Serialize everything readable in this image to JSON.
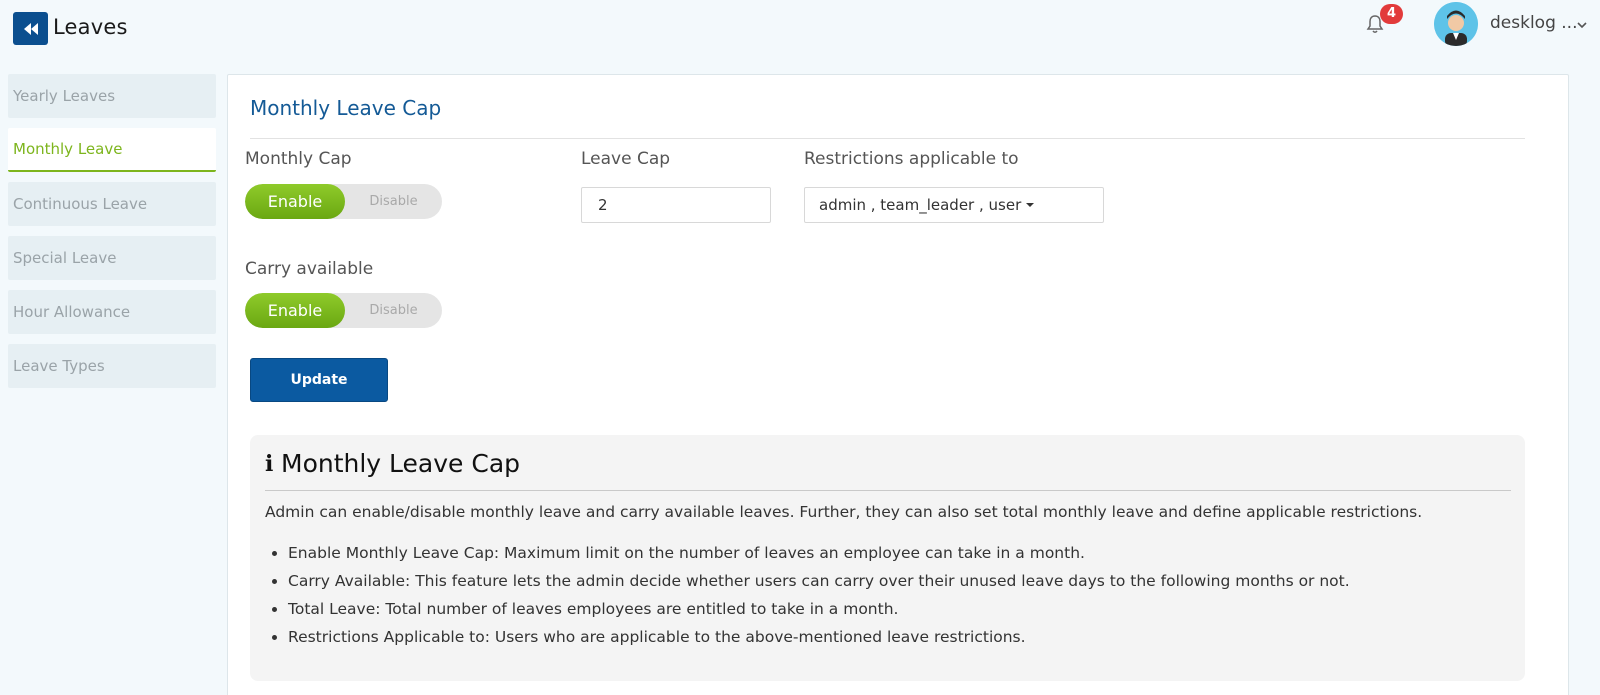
{
  "header": {
    "title": "Leaves",
    "notification_count": "4",
    "user_name": "desklog ..."
  },
  "sidebar": {
    "items": [
      {
        "label": "Yearly Leaves"
      },
      {
        "label": "Monthly Leave"
      },
      {
        "label": "Continuous Leave"
      },
      {
        "label": "Special Leave"
      },
      {
        "label": "Hour Allowance"
      },
      {
        "label": "Leave Types"
      }
    ],
    "active_index": 1
  },
  "main": {
    "title": "Monthly Leave Cap",
    "monthly_cap": {
      "label": "Monthly Cap",
      "on_label": "Enable",
      "off_label": "Disable"
    },
    "leave_cap": {
      "label": "Leave Cap",
      "value": "2"
    },
    "restrictions": {
      "label": "Restrictions applicable to",
      "value": "admin , team_leader , user"
    },
    "carry_available": {
      "label": "Carry available",
      "on_label": "Enable",
      "off_label": "Disable"
    },
    "update_label": "Update"
  },
  "info": {
    "heading": "Monthly Leave Cap",
    "description": "Admin can enable/disable monthly leave and carry available leaves. Further, they can also set total monthly leave and define applicable restrictions.",
    "bullets": [
      "Enable Monthly Leave Cap: Maximum limit on the number of leaves an employee can take in a month.",
      "Carry Available: This feature lets the admin decide whether users can carry over their unused leave days to the following months or not.",
      "Total Leave: Total number of leaves employees are entitled to take in a month.",
      "Restrictions Applicable to: Users who are applicable to the above-mentioned leave restrictions."
    ]
  },
  "colors": {
    "primary": "#0b4f8f",
    "accent_green": "#7db51d",
    "title_blue": "#145a96",
    "badge_red": "#e23b3b"
  },
  "icons": [
    "back-double-chevron-icon",
    "bell-icon",
    "chevron-down-icon",
    "info-icon"
  ]
}
